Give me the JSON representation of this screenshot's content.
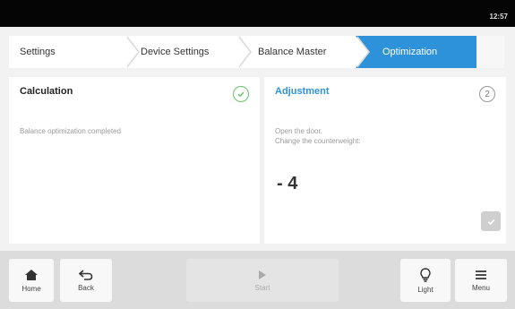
{
  "status": {
    "time": "12:57"
  },
  "breadcrumb": [
    {
      "label": "Settings"
    },
    {
      "label": "Device Settings"
    },
    {
      "label": "Balance Master"
    },
    {
      "label": "Optimization"
    }
  ],
  "panels": {
    "calculation": {
      "title": "Calculation",
      "message": "Balance optimization completed"
    },
    "adjustment": {
      "title": "Adjustment",
      "step": "2",
      "line1": "Open the door.",
      "line2": "Change the counterweight:",
      "value": "- 4"
    }
  },
  "bottom": {
    "home": "Home",
    "back": "Back",
    "start": "Start",
    "light": "Light",
    "menu": "Menu"
  },
  "colors": {
    "accent": "#2e92db",
    "success": "#66c36b"
  }
}
